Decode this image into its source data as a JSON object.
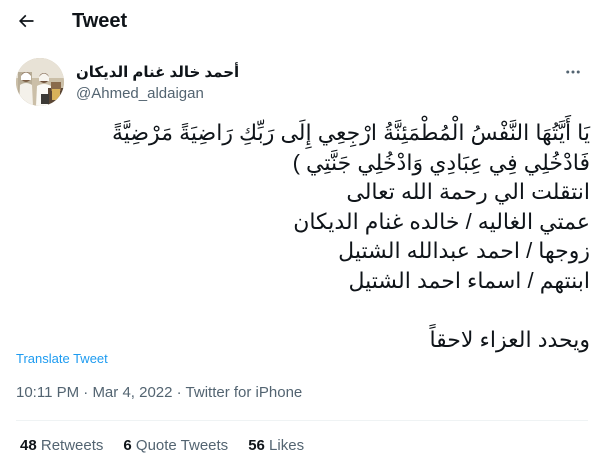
{
  "header": {
    "title": "Tweet",
    "back_icon": "arrow-left-icon"
  },
  "author": {
    "display_name": "أحمد خالد غنام الديكان",
    "handle": "@Ahmed_aldaigan"
  },
  "more_icon": "more-horizontal-icon",
  "tweet": {
    "lines": [
      "يَا أَيَّتُهَا النَّفْسُ الْمُطْمَئِنَّةُ ارْجِعِي إِلَى رَبِّكِ رَاضِيَةً مَرْضِيَّةً",
      "فَادْخُلِي فِي عِبَادِي وَادْخُلِي جَنَّتِي )",
      "انتقلت الي رحمة الله تعالى",
      "عمتي الغاليه / خالده غنام الديكان",
      "زوجها / احمد عبدالله  الشتيل",
      "ابنتهم / اسماء احمد  الشتيل",
      "",
      "ويحدد العزاء لاحقاً"
    ]
  },
  "translate_label": "Translate Tweet",
  "meta": {
    "time": "10:11 PM",
    "separator": " · ",
    "date": "Mar 4, 2022",
    "source": "Twitter for iPhone"
  },
  "stats": {
    "retweets_count": "48",
    "retweets_label": "Retweets",
    "quotes_count": "6",
    "quotes_label": "Quote Tweets",
    "likes_count": "56",
    "likes_label": "Likes"
  },
  "colors": {
    "text_primary": "#0f1419",
    "text_secondary": "#536471",
    "link": "#1d9bf0",
    "divider": "#eff3f4"
  }
}
